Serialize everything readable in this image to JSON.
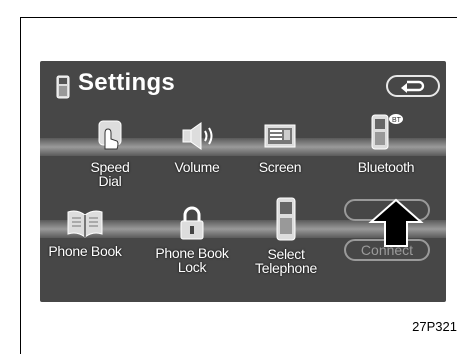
{
  "header": {
    "title": "Settings"
  },
  "row1": [
    {
      "lines": [
        "Speed",
        "Dial"
      ]
    },
    {
      "lines": [
        "Volume"
      ]
    },
    {
      "lines": [
        "Screen"
      ]
    },
    {
      "lines": [
        "Bluetooth"
      ]
    }
  ],
  "row2": [
    {
      "lines": [
        "Phone Book"
      ]
    },
    {
      "lines": [
        "Phone Book",
        "Lock"
      ]
    },
    {
      "lines": [
        "Select",
        "Telephone"
      ]
    }
  ],
  "ghost": {
    "connect_label": "Connect"
  },
  "caption": "27P321"
}
